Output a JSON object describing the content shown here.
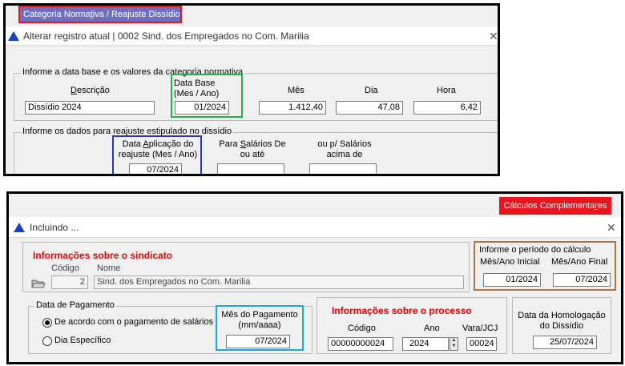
{
  "top": {
    "tab_label_pre": "Categoria Norma",
    "tab_label_ul": "t",
    "tab_label_post": "iva / Reajuste Dissídio",
    "dialog_title": "Alterar registro atual | 0002 Sind. dos Empregados no Com. Marilia",
    "section1_caption": "Informe a data base e os valores da categoria normativa",
    "descricao_ul": "D",
    "descricao_rest": "escrição",
    "descricao_value": "Dissídio 2024",
    "data_base_label": "Data Base (Mes / Ano)",
    "data_base_value": "01/2024",
    "mes_label": "Mês",
    "mes_value": "1.412,40",
    "dia_label": "Dia",
    "dia_value": "47,08",
    "hora_label": "Hora",
    "hora_value": "6,42",
    "section2_caption": "Informe os dados para reajuste estipulado no dissídio",
    "data_aplic_pre": "Data ",
    "data_aplic_ul": "A",
    "data_aplic_post": "plicação  do reajuste (Mes / Ano)",
    "data_aplic_value": "07/2024",
    "salarios_pre": "Para ",
    "salarios_ul": "S",
    "salarios_post": "alários De ou até",
    "salarios_value": "",
    "acima_label": "ou p/ Salários acima de",
    "acima_value": ""
  },
  "bottom": {
    "tab_label_pre": "Cálculos Complementa",
    "tab_label_ul": "r",
    "tab_label_post": "es",
    "dialog_title": "Incluindo ...",
    "sindicato_title": "Informações sobre o sindicato",
    "codigo_label": "Código",
    "codigo_value": "2",
    "nome_label": "Nome",
    "nome_value": "Sind. dos Empregados no Com. Marilia",
    "periodo_caption": "Informe o período do cálculo",
    "mes_inicial_label": "Mês/Ano Inicial",
    "mes_inicial_value": "01/2024",
    "mes_final_label": "Mês/Ano Final",
    "mes_final_value": "07/2024",
    "data_pagamento_caption": "Data de Pagamento",
    "radio_acordo": "De acordo com o pagamento de salários",
    "radio_especifico": "Dia Específico",
    "mes_pagamento_label": "Mês do Pagamento (mm/aaaa)",
    "mes_pagamento_value": "07/2024",
    "processo_title": "Informações sobre o processo",
    "proc_codigo_label": "Código",
    "proc_codigo_value": "00000000024",
    "ano_label": "Ano",
    "ano_value": "2024",
    "vara_label": "Vara/JCJ",
    "vara_value": "00024",
    "homologacao_label": "Data da Homologação do Dissídio",
    "homologacao_value": "25/07/2024"
  },
  "colors": {
    "tab_blue": "#6f6fc2",
    "tab_red": "#e8141e",
    "highlight_red": "#e8141e",
    "highlight_green": "#1fb24a",
    "highlight_blue": "#2d3aa8",
    "highlight_cyan": "#1aa7e0",
    "highlight_brown": "#a8764e",
    "title_red": "#e00000"
  }
}
